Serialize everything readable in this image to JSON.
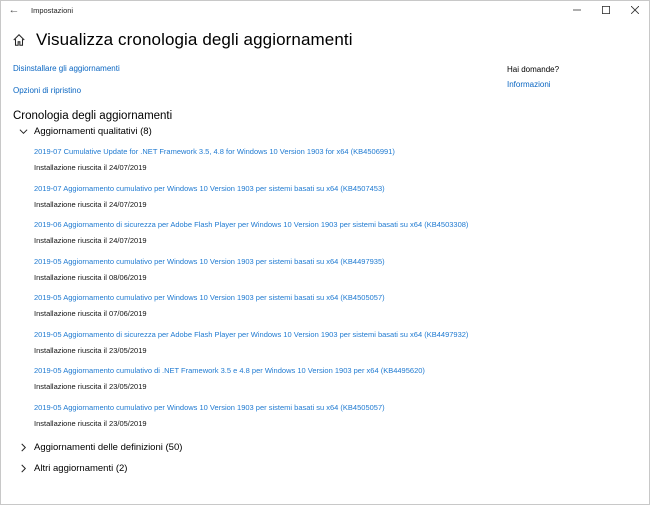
{
  "window": {
    "title": "Impostazioni",
    "back_glyph": "←",
    "minimize_glyph": "—",
    "maximize_glyph": "□",
    "close_glyph": "✕"
  },
  "header": {
    "title": "Visualizza cronologia degli aggiornamenti",
    "icon": "home-icon"
  },
  "links": {
    "uninstall": "Disinstallare gli aggiornamenti",
    "recovery": "Opzioni di ripristino"
  },
  "sidebar": {
    "question": "Hai domande?",
    "info_link": "Informazioni"
  },
  "history": {
    "title": "Cronologia degli aggiornamenti",
    "groups": [
      {
        "label": "Aggiornamenti qualitativi (8)",
        "expanded": true
      },
      {
        "label": "Aggiornamenti delle definizioni (50)",
        "expanded": false
      },
      {
        "label": "Altri aggiornamenti (2)",
        "expanded": false
      }
    ],
    "updates": [
      {
        "name": "2019-07 Cumulative Update for .NET Framework 3.5, 4.8 for Windows 10 Version 1903 for x64 (KB4506991)",
        "status": "Installazione riuscita il 24/07/2019"
      },
      {
        "name": "2019-07 Aggiornamento cumulativo per Windows 10 Version 1903 per sistemi basati su x64 (KB4507453)",
        "status": "Installazione riuscita il 24/07/2019"
      },
      {
        "name": "2019-06 Aggiornamento di sicurezza per Adobe Flash Player per Windows 10 Version 1903 per sistemi basati su x64 (KB4503308)",
        "status": "Installazione riuscita il 24/07/2019"
      },
      {
        "name": "2019-05 Aggiornamento cumulativo per Windows 10 Version 1903 per sistemi basati su x64 (KB4497935)",
        "status": "Installazione riuscita il 08/06/2019"
      },
      {
        "name": "2019-05 Aggiornamento cumulativo per Windows 10 Version 1903 per sistemi basati su x64 (KB4505057)",
        "status": "Installazione riuscita il 07/06/2019"
      },
      {
        "name": "2019-05 Aggiornamento di sicurezza per Adobe Flash Player per Windows 10 Version 1903 per sistemi basati su x64 (KB4497932)",
        "status": "Installazione riuscita il 23/05/2019"
      },
      {
        "name": "2019-05 Aggiornamento cumulativo di .NET Framework 3.5 e 4.8 per Windows 10 Version 1903 per x64 (KB4495620)",
        "status": "Installazione riuscita il 23/05/2019"
      },
      {
        "name": "2019-05 Aggiornamento cumulativo per Windows 10 Version 1903 per sistemi basati su x64 (KB4505057)",
        "status": "Installazione riuscita il 23/05/2019"
      }
    ]
  },
  "colors": {
    "link": "#1f7ad1",
    "text": "#000000",
    "background": "#ffffff"
  }
}
